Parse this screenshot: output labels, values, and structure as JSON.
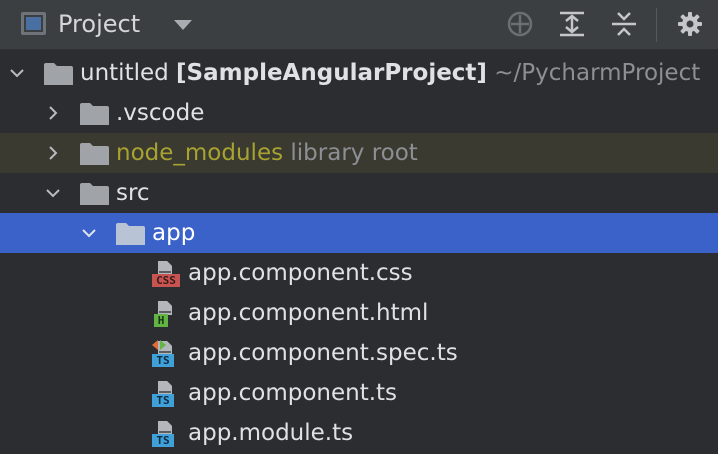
{
  "header": {
    "title": "Project",
    "icons": [
      "project-icon",
      "dropdown-arrow-icon",
      "locate-icon",
      "expand-all-icon",
      "collapse-all-icon",
      "gear-icon"
    ]
  },
  "tree": {
    "root": {
      "name": "untitled",
      "module": "[SampleAngularProject]",
      "path": "~/PycharmProject"
    },
    "vscode": {
      "name": ".vscode"
    },
    "node_modules": {
      "name": "node_modules",
      "note": "library root"
    },
    "src": {
      "name": "src"
    },
    "app": {
      "name": "app"
    },
    "files": [
      {
        "name": "app.component.css",
        "badge": "CSS"
      },
      {
        "name": "app.component.html",
        "badge": "H"
      },
      {
        "name": "app.component.spec.ts",
        "badge": "TS"
      },
      {
        "name": "app.component.ts",
        "badge": "TS"
      },
      {
        "name": "app.module.ts",
        "badge": "TS"
      }
    ]
  },
  "colors": {
    "background": "#2b2d30",
    "header": "#3c3f41",
    "selection": "#3a62c9",
    "excluded_row": "#3b3a31",
    "library_text": "#a8a330",
    "css_badge": "#c75450",
    "html_badge": "#62b543",
    "ts_badge": "#40a1d8"
  }
}
